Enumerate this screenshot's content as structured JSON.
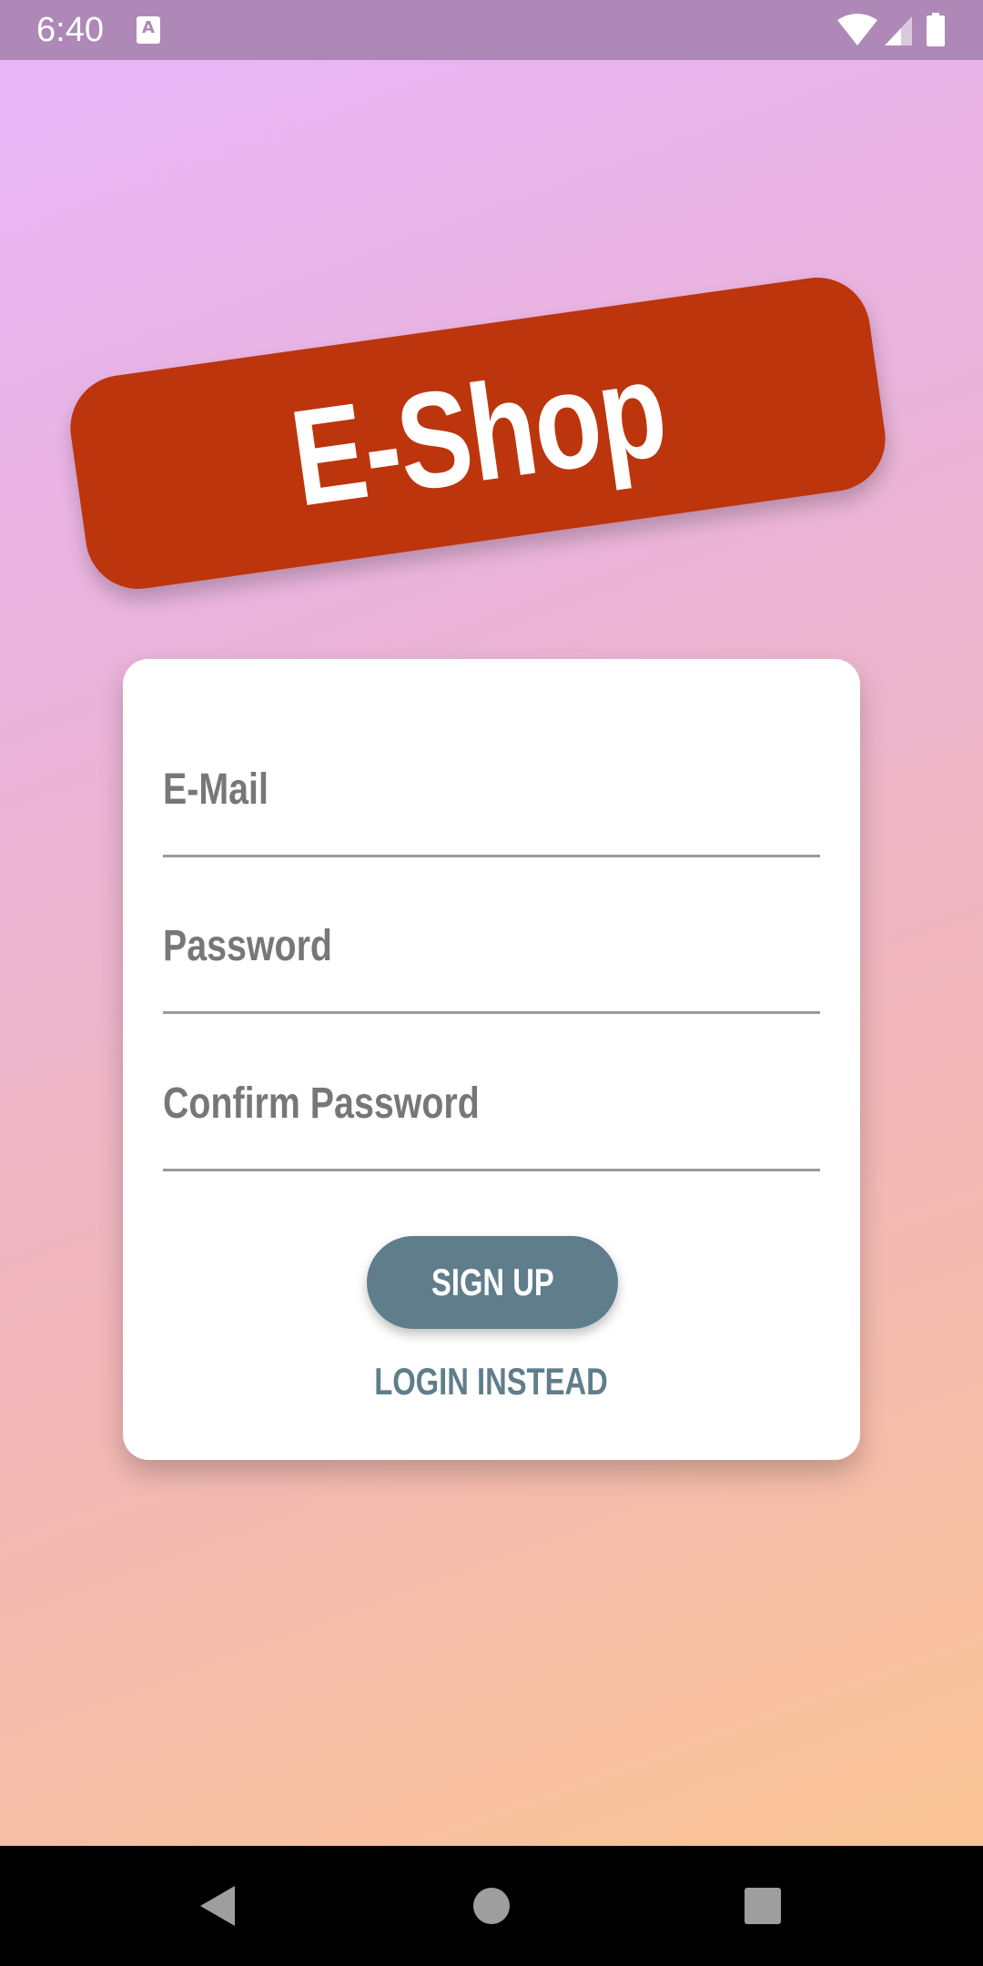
{
  "status_bar": {
    "time": "6:40",
    "notification_icon": "A",
    "icons": [
      "wifi-icon",
      "signal-icon",
      "battery-icon"
    ]
  },
  "logo": {
    "text": "E-Shop"
  },
  "form": {
    "email_label": "E-Mail",
    "password_label": "Password",
    "confirm_password_label": "Confirm Password",
    "signup_button": "SIGN UP",
    "login_instead_link": "LOGIN INSTEAD"
  },
  "nav_bar": {
    "buttons": [
      "back-icon",
      "home-icon",
      "recents-icon"
    ]
  },
  "colors": {
    "status_bar": "#ae88b6",
    "logo_badge": "#bd350c",
    "primary": "#607d8b",
    "label": "#777777",
    "gradient_start": "#e8b6fa",
    "gradient_end": "#fbc690"
  }
}
